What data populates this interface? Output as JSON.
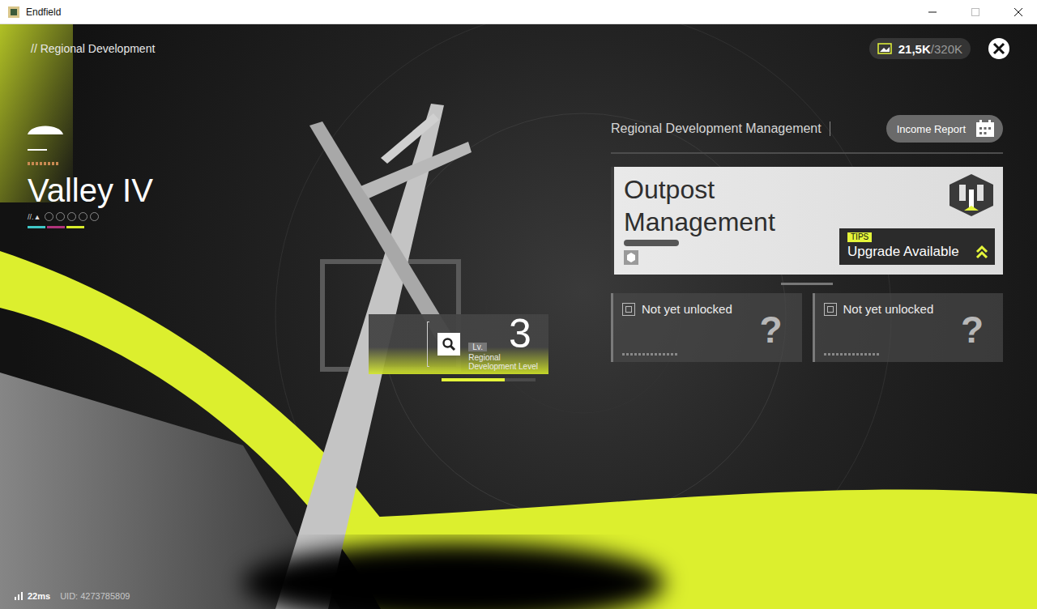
{
  "window": {
    "title": "Endfield"
  },
  "header": {
    "breadcrumb": "// Regional Development",
    "currency": {
      "amount": "21,5K",
      "capacity": "/320K"
    }
  },
  "region": {
    "name": "Valley IV",
    "marker": "//.▲",
    "progress_dots": [
      {
        "filled": false
      },
      {
        "filled": false
      },
      {
        "filled": false
      },
      {
        "filled": false
      },
      {
        "filled": false
      }
    ]
  },
  "level": {
    "prefix": "Lv.",
    "value": "3",
    "label": "Regional Development Level",
    "level": 0.67
  },
  "management": {
    "title": "Regional Development Management",
    "income_button": "Income Report",
    "featured": {
      "title": "Outpost Management",
      "tip_tag": "TIPS",
      "tip": "Upgrade Available"
    },
    "locked": [
      {
        "title": "Not yet unlocked",
        "mark": "?"
      },
      {
        "title": "Not yet unlocked",
        "mark": "?"
      }
    ]
  },
  "status_bar": {
    "ping": "22ms",
    "uid": "UID: 4273785809"
  }
}
